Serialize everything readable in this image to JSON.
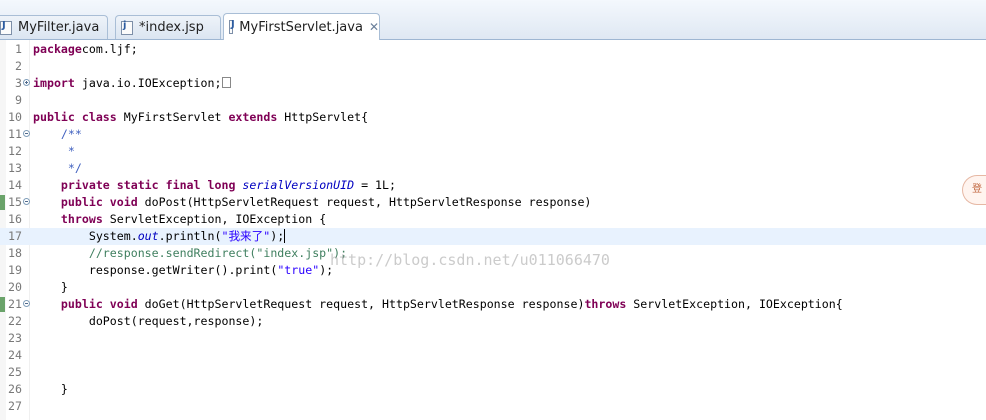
{
  "tabs": [
    {
      "label": "MyFilter.java",
      "icon": "java-file-icon",
      "active": false
    },
    {
      "label": "*index.jsp",
      "icon": "jsp-file-icon",
      "active": false
    },
    {
      "label": "MyFirstServlet.java",
      "icon": "java-file-icon",
      "active": true
    }
  ],
  "close_glyph": "✕",
  "watermark": "http://blog.csdn.net/u011066470",
  "side_bubble_text": "登",
  "lines": [
    {
      "n": "1",
      "seg": [
        [
          "kw",
          "package"
        ],
        [
          "",
          "com.ljf;"
        ]
      ]
    },
    {
      "n": "2",
      "seg": []
    },
    {
      "n": "3",
      "fold": "plus",
      "seg": [
        [
          "kw",
          "import"
        ],
        [
          "",
          " java.io.IOException;"
        ],
        [
          "box",
          ""
        ]
      ]
    },
    {
      "n": "9",
      "seg": []
    },
    {
      "n": "10",
      "seg": [
        [
          "kw",
          "public class"
        ],
        [
          "",
          " MyFirstServlet "
        ],
        [
          "kw",
          "extends"
        ],
        [
          "",
          " HttpServlet{"
        ]
      ]
    },
    {
      "n": "11",
      "fold": "minus",
      "seg": [
        [
          "",
          "    "
        ],
        [
          "cm",
          "/**"
        ]
      ]
    },
    {
      "n": "12",
      "seg": [
        [
          "",
          "     "
        ],
        [
          "cm",
          "*"
        ]
      ]
    },
    {
      "n": "13",
      "seg": [
        [
          "",
          "     "
        ],
        [
          "cm",
          "*/"
        ]
      ]
    },
    {
      "n": "14",
      "seg": [
        [
          "",
          "    "
        ],
        [
          "kw",
          "private static final long"
        ],
        [
          "",
          " "
        ],
        [
          "fi",
          "serialVersionUID"
        ],
        [
          "",
          " = 1L;"
        ]
      ]
    },
    {
      "n": "15",
      "fold": "minus",
      "marker": true,
      "seg": [
        [
          "",
          "    "
        ],
        [
          "kw",
          "public void"
        ],
        [
          "",
          " doPost(HttpServletRequest request, HttpServletResponse response)"
        ]
      ]
    },
    {
      "n": "16",
      "seg": [
        [
          "",
          "    "
        ],
        [
          "kw",
          "throws"
        ],
        [
          "",
          " ServletException, IOException {"
        ]
      ]
    },
    {
      "n": "17",
      "current": true,
      "seg": [
        [
          "",
          "        System."
        ],
        [
          "fi",
          "out"
        ],
        [
          "",
          ".println("
        ],
        [
          "st",
          "\"我来了\""
        ],
        [
          "",
          ");"
        ],
        [
          "caret",
          ""
        ]
      ]
    },
    {
      "n": "18",
      "seg": [
        [
          "",
          "        "
        ],
        [
          "lc",
          "//response.sendRedirect(\"index.jsp\");"
        ]
      ]
    },
    {
      "n": "19",
      "seg": [
        [
          "",
          "        response.getWriter().print("
        ],
        [
          "st",
          "\"true\""
        ],
        [
          "",
          ");"
        ]
      ]
    },
    {
      "n": "20",
      "seg": [
        [
          "",
          "    }"
        ]
      ]
    },
    {
      "n": "21",
      "fold": "minus",
      "marker": true,
      "seg": [
        [
          "",
          "    "
        ],
        [
          "kw",
          "public void"
        ],
        [
          "",
          " doGet(HttpServletRequest request, HttpServletResponse response)"
        ],
        [
          "kw",
          "throws"
        ],
        [
          "",
          " ServletException, IOException{"
        ]
      ]
    },
    {
      "n": "22",
      "seg": [
        [
          "",
          "        doPost(request,response);"
        ]
      ]
    },
    {
      "n": "23",
      "seg": []
    },
    {
      "n": "24",
      "seg": []
    },
    {
      "n": "25",
      "seg": []
    },
    {
      "n": "26",
      "seg": [
        [
          "",
          "    }"
        ]
      ]
    },
    {
      "n": "27",
      "seg": []
    }
  ]
}
